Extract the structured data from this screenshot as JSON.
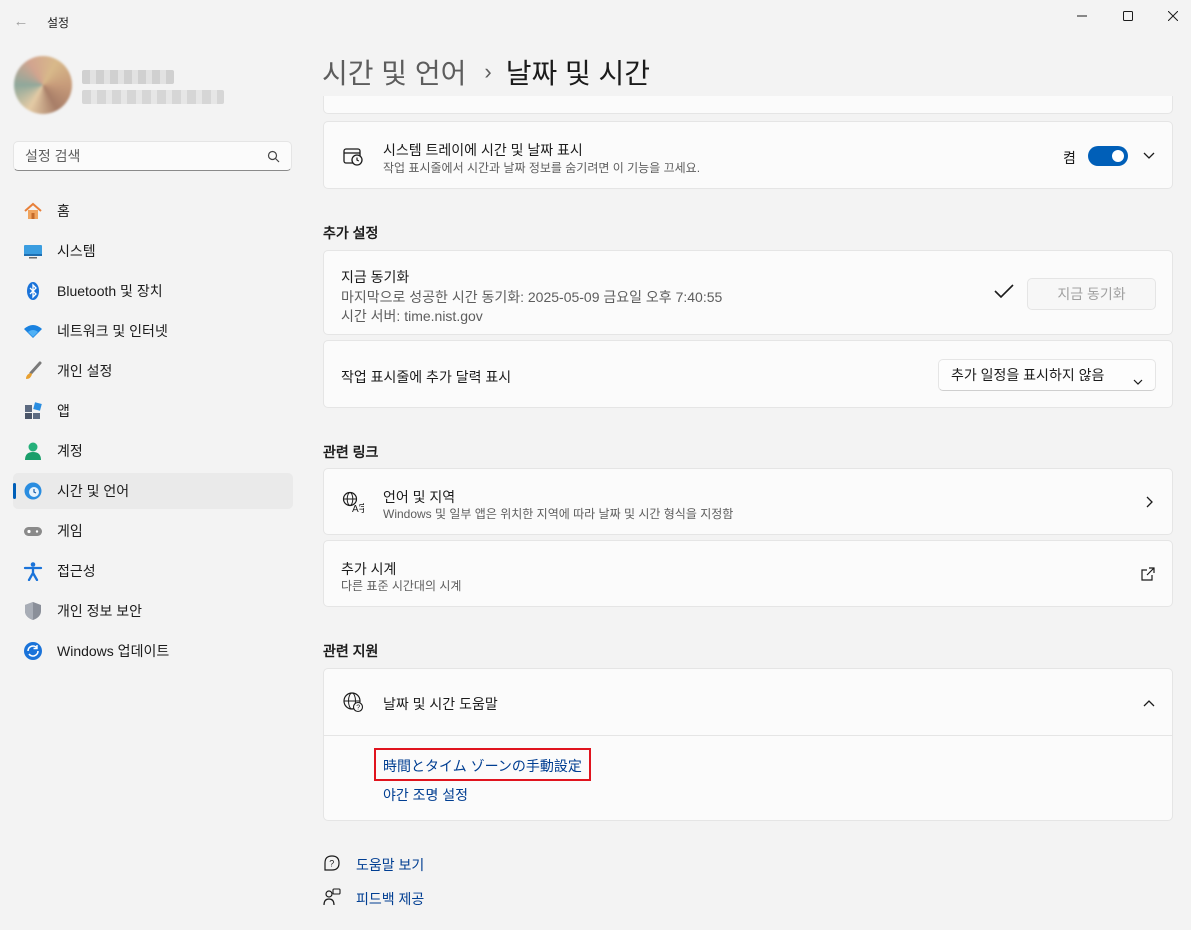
{
  "window": {
    "app_title": "설정",
    "back_glyph": "←",
    "min_glyph": "─",
    "max_glyph": "☐",
    "close_glyph": "✕"
  },
  "search": {
    "placeholder": "설정 검색"
  },
  "sidebar": {
    "items": [
      {
        "label": "홈",
        "icon": "home-icon"
      },
      {
        "label": "시스템",
        "icon": "system-icon"
      },
      {
        "label": "Bluetooth 및 장치",
        "icon": "bluetooth-icon"
      },
      {
        "label": "네트워크 및 인터넷",
        "icon": "wifi-icon"
      },
      {
        "label": "개인 설정",
        "icon": "brush-icon"
      },
      {
        "label": "앱",
        "icon": "apps-icon"
      },
      {
        "label": "계정",
        "icon": "account-icon"
      },
      {
        "label": "시간 및 언어",
        "icon": "time-language-icon",
        "active": true
      },
      {
        "label": "게임",
        "icon": "gamepad-icon"
      },
      {
        "label": "접근성",
        "icon": "accessibility-icon"
      },
      {
        "label": "개인 정보 보안",
        "icon": "shield-icon"
      },
      {
        "label": "Windows 업데이트",
        "icon": "update-icon"
      }
    ]
  },
  "breadcrumb": {
    "parent": "시간 및 언어",
    "separator": "›",
    "current": "날짜 및 시간"
  },
  "tray_row": {
    "title": "시스템 트레이에 시간 및 날짜 표시",
    "subtitle": "작업 표시줄에서 시간과 날짜 정보를 숨기려면 이 기능을 끄세요.",
    "toggle_label": "켬",
    "toggle_on": true
  },
  "additional_settings": {
    "heading": "추가 설정",
    "sync": {
      "title": "지금 동기화",
      "last_sync": "마지막으로 성공한 시간 동기화: 2025-05-09 금요일 오후 7:40:55",
      "server": "시간 서버: time.nist.gov",
      "button": "지금 동기화",
      "check_glyph": "✓"
    },
    "calendar": {
      "title": "작업 표시줄에 추가 달력 표시",
      "dropdown_value": "추가 일정을 표시하지 않음"
    }
  },
  "related_links": {
    "heading": "관련 링크",
    "language_region": {
      "title": "언어 및 지역",
      "subtitle": "Windows 및 일부 앱은 위치한 지역에 따라 날짜 및 시간 형식을 지정함"
    },
    "additional_clocks": {
      "title": "추가 시계",
      "subtitle": "다른 표준 시간대의 시계"
    }
  },
  "related_support": {
    "heading": "관련 지원",
    "help_title": "날짜 및 시간 도움말",
    "links": [
      "時間とタイム ゾーンの手動設定",
      "야간 조명 설정"
    ]
  },
  "footer": {
    "get_help": "도움말 보기",
    "feedback": "피드백 제공"
  },
  "colors": {
    "accent": "#005fb8",
    "link": "#003e92",
    "highlight": "#e0141e"
  }
}
